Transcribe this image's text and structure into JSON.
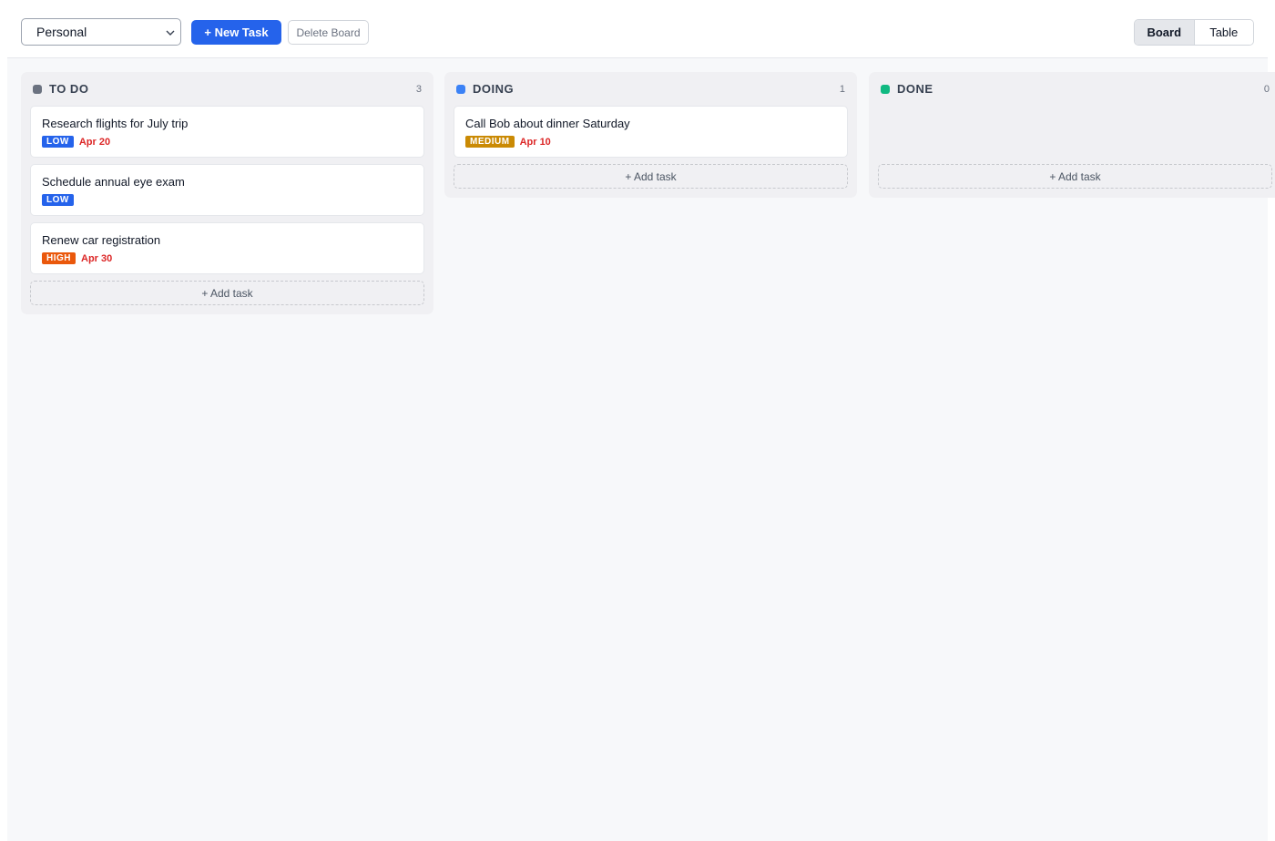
{
  "toolbar": {
    "board_select_value": "Personal",
    "new_task_label": "+ New Task",
    "delete_board_label": "Delete Board",
    "view_options": [
      "Board",
      "Table"
    ],
    "active_view": "Board"
  },
  "colors": {
    "primary": "#2563eb",
    "todo": "#6b7280",
    "doing": "#3b82f6",
    "done": "#10b981",
    "low": "#2563eb",
    "medium": "#ca8a04",
    "high": "#ea580c",
    "due": "#dc2626"
  },
  "columns": [
    {
      "title": "TO DO",
      "count": "3",
      "add_label": "+ Add task",
      "cards": [
        {
          "title": "Research flights for July trip",
          "priority": "LOW",
          "due": "Apr 20"
        },
        {
          "title": "Schedule annual eye exam",
          "priority": "LOW",
          "due": ""
        },
        {
          "title": "Renew car registration",
          "priority": "HIGH",
          "due": "Apr 30"
        }
      ]
    },
    {
      "title": "DOING",
      "count": "1",
      "add_label": "+ Add task",
      "cards": [
        {
          "title": "Call Bob about dinner Saturday",
          "priority": "MEDIUM",
          "due": "Apr 10"
        }
      ]
    },
    {
      "title": "DONE",
      "count": "0",
      "add_label": "+ Add task",
      "cards": []
    }
  ]
}
